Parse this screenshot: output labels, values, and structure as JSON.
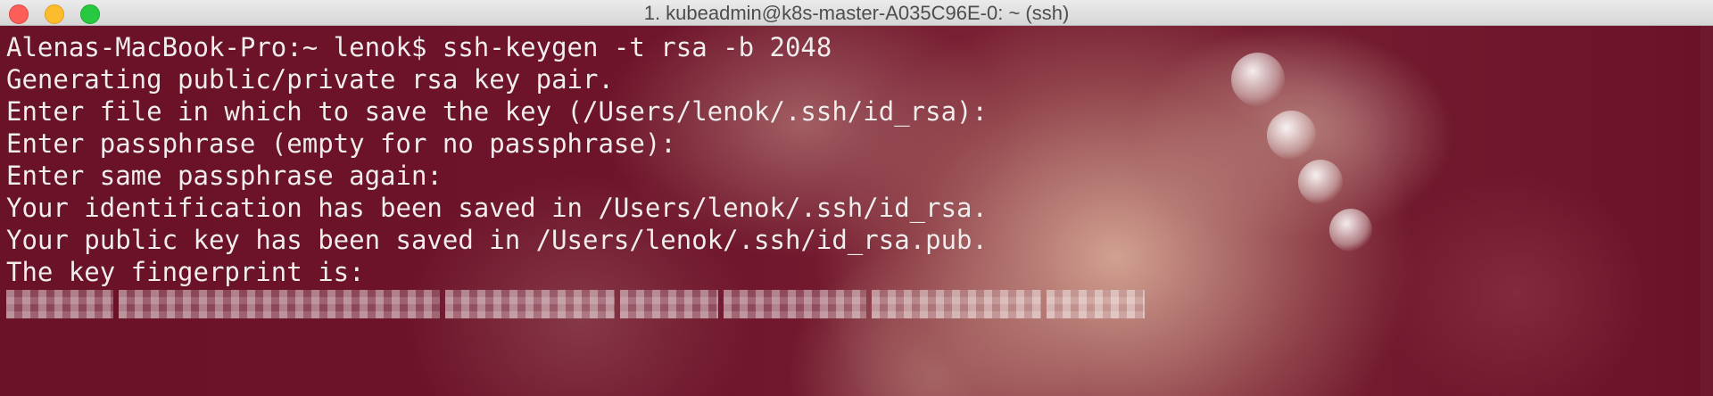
{
  "window": {
    "title": "1. kubeadmin@k8s-master-A035C96E-0: ~ (ssh)",
    "controls": {
      "close_icon": "close-icon",
      "minimize_icon": "minimize-icon",
      "zoom_icon": "zoom-icon",
      "colors": {
        "close": "#fc5f57",
        "minimize": "#fdbc2e",
        "zoom": "#28c840"
      }
    }
  },
  "terminal": {
    "background_color": "#6a1228",
    "text_color": "#f2ecec",
    "lines": [
      "Alenas-MacBook-Pro:~ lenok$ ssh-keygen -t rsa -b 2048",
      "Generating public/private rsa key pair.",
      "Enter file in which to save the key (/Users/lenok/.ssh/id_rsa):",
      "Enter passphrase (empty for no passphrase):",
      "Enter same passphrase again:",
      "Your identification has been saved in /Users/lenok/.ssh/id_rsa.",
      "Your public key has been saved in /Users/lenok/.ssh/id_rsa.pub.",
      "The key fingerprint is:"
    ],
    "redacted_line": "fingerprint-redacted"
  }
}
